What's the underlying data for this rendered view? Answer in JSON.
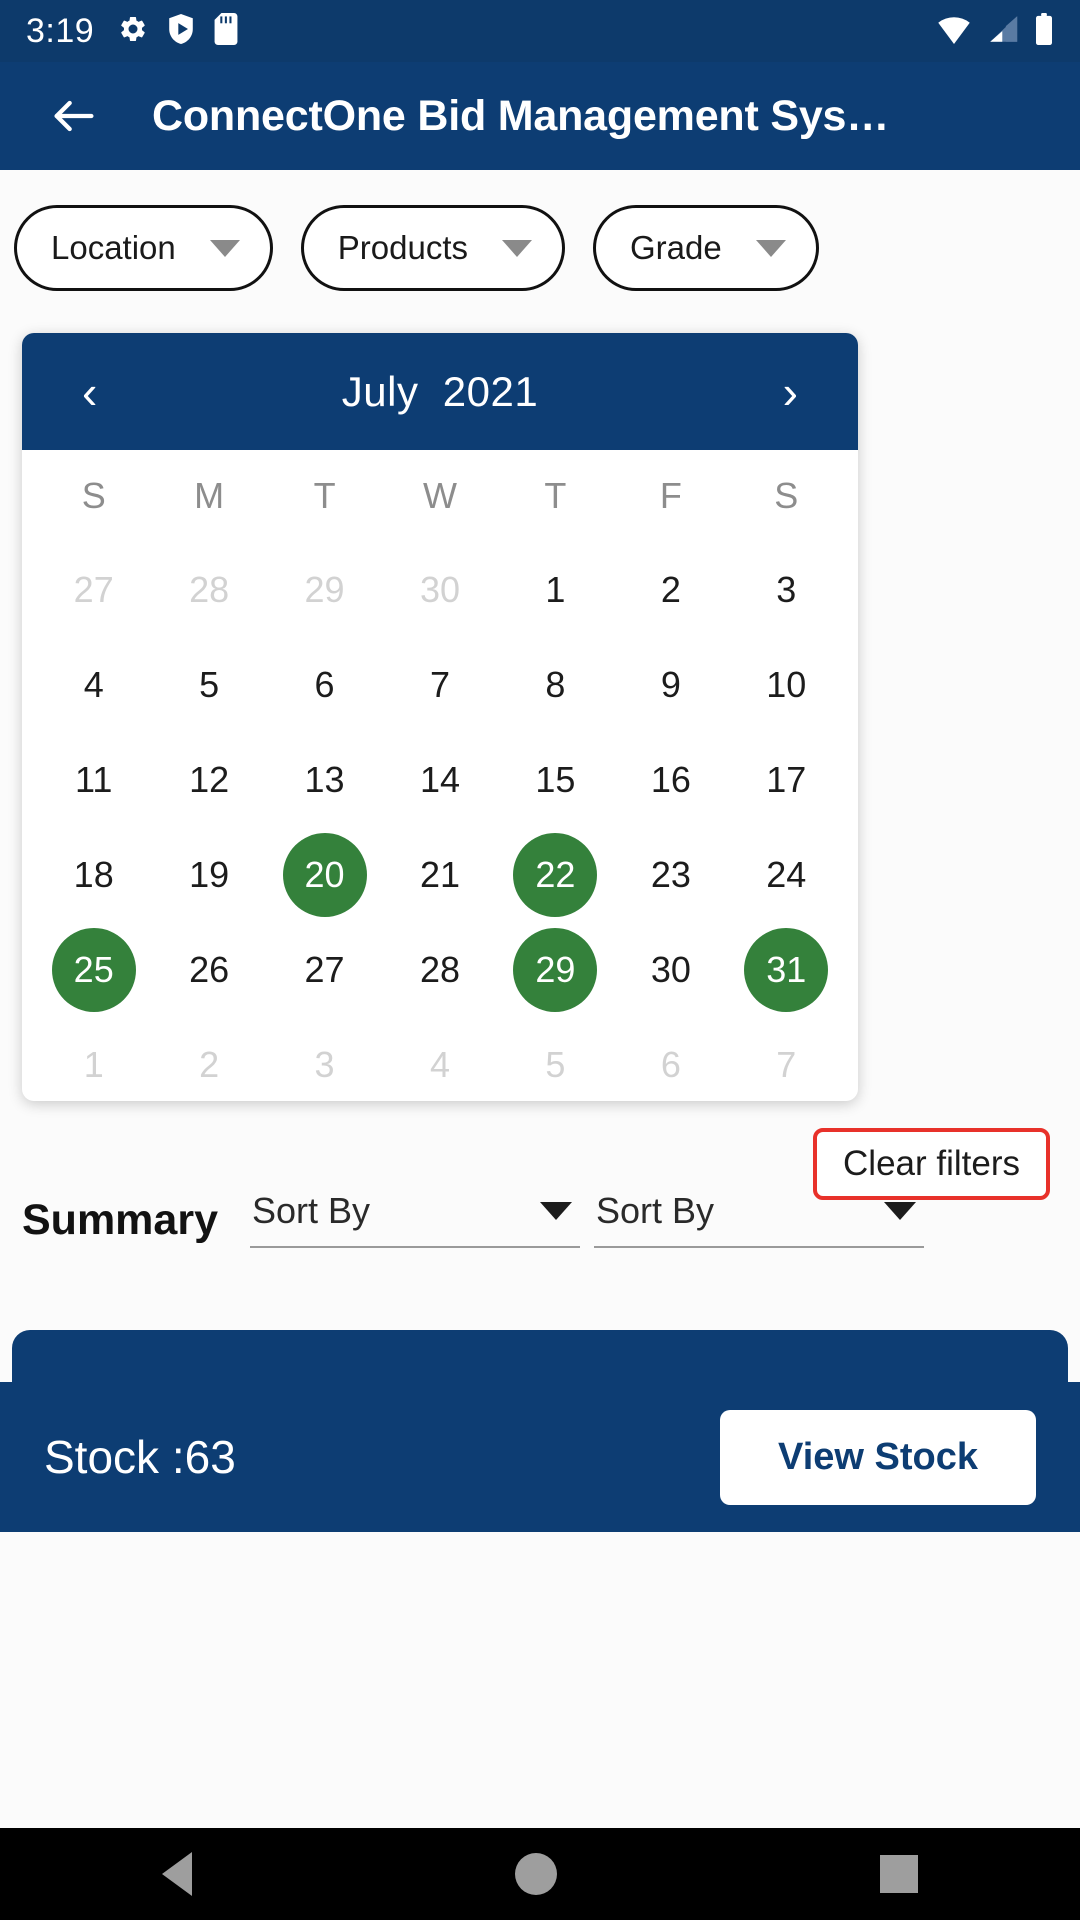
{
  "status_bar": {
    "time": "3:19",
    "left_icons": [
      "gear-icon",
      "shield-play-icon",
      "sd-card-icon"
    ],
    "right_icons": [
      "wifi-icon",
      "cellular-signal-icon",
      "battery-icon"
    ]
  },
  "app_bar": {
    "back_icon": "back-arrow-icon",
    "title": "ConnectOne Bid Management Sys…"
  },
  "filters": {
    "chips": [
      {
        "label": "Location",
        "caret": "chevron-down-icon"
      },
      {
        "label": "Products",
        "caret": "chevron-down-icon"
      },
      {
        "label": "Grade",
        "caret": "chevron-down-icon"
      }
    ]
  },
  "calendar": {
    "prev_label": "‹",
    "next_label": "›",
    "title": "July  2021",
    "month": "July",
    "year": "2021",
    "weekdays": [
      "S",
      "M",
      "T",
      "W",
      "T",
      "F",
      "S"
    ],
    "weeks": [
      [
        {
          "d": "27",
          "muted": true,
          "selected": false
        },
        {
          "d": "28",
          "muted": true,
          "selected": false
        },
        {
          "d": "29",
          "muted": true,
          "selected": false
        },
        {
          "d": "30",
          "muted": true,
          "selected": false
        },
        {
          "d": "1",
          "muted": false,
          "selected": false
        },
        {
          "d": "2",
          "muted": false,
          "selected": false
        },
        {
          "d": "3",
          "muted": false,
          "selected": false
        }
      ],
      [
        {
          "d": "4",
          "muted": false,
          "selected": false
        },
        {
          "d": "5",
          "muted": false,
          "selected": false
        },
        {
          "d": "6",
          "muted": false,
          "selected": false
        },
        {
          "d": "7",
          "muted": false,
          "selected": false
        },
        {
          "d": "8",
          "muted": false,
          "selected": false
        },
        {
          "d": "9",
          "muted": false,
          "selected": false
        },
        {
          "d": "10",
          "muted": false,
          "selected": false
        }
      ],
      [
        {
          "d": "11",
          "muted": false,
          "selected": false
        },
        {
          "d": "12",
          "muted": false,
          "selected": false
        },
        {
          "d": "13",
          "muted": false,
          "selected": false
        },
        {
          "d": "14",
          "muted": false,
          "selected": false
        },
        {
          "d": "15",
          "muted": false,
          "selected": false
        },
        {
          "d": "16",
          "muted": false,
          "selected": false
        },
        {
          "d": "17",
          "muted": false,
          "selected": false
        }
      ],
      [
        {
          "d": "18",
          "muted": false,
          "selected": false
        },
        {
          "d": "19",
          "muted": false,
          "selected": false
        },
        {
          "d": "20",
          "muted": false,
          "selected": true
        },
        {
          "d": "21",
          "muted": false,
          "selected": false
        },
        {
          "d": "22",
          "muted": false,
          "selected": true
        },
        {
          "d": "23",
          "muted": false,
          "selected": false
        },
        {
          "d": "24",
          "muted": false,
          "selected": false
        }
      ],
      [
        {
          "d": "25",
          "muted": false,
          "selected": true
        },
        {
          "d": "26",
          "muted": false,
          "selected": false
        },
        {
          "d": "27",
          "muted": false,
          "selected": false
        },
        {
          "d": "28",
          "muted": false,
          "selected": false
        },
        {
          "d": "29",
          "muted": false,
          "selected": true
        },
        {
          "d": "30",
          "muted": false,
          "selected": false
        },
        {
          "d": "31",
          "muted": false,
          "selected": true
        }
      ],
      [
        {
          "d": "1",
          "muted": true,
          "selected": false
        },
        {
          "d": "2",
          "muted": true,
          "selected": false
        },
        {
          "d": "3",
          "muted": true,
          "selected": false
        },
        {
          "d": "4",
          "muted": true,
          "selected": false
        },
        {
          "d": "5",
          "muted": true,
          "selected": false
        },
        {
          "d": "6",
          "muted": true,
          "selected": false
        },
        {
          "d": "7",
          "muted": true,
          "selected": false
        }
      ]
    ],
    "selected_days": [
      "20",
      "22",
      "25",
      "29",
      "31"
    ]
  },
  "actions": {
    "clear_filters": "Clear filters"
  },
  "summary": {
    "title": "Summary",
    "sort_fields": [
      {
        "label": "Sort By",
        "caret": "chevron-down-icon"
      },
      {
        "label": "Sort By",
        "caret": "chevron-down-icon"
      }
    ]
  },
  "stock": {
    "label": "Stock :63",
    "view_button": "View Stock"
  },
  "nav_bar": {
    "back": "nav-back-icon",
    "home": "nav-home-icon",
    "recents": "nav-recents-icon"
  },
  "colors": {
    "navy": "#0d3d73",
    "status_navy": "#0d3a6b",
    "selected_green": "#34813b",
    "highlight_red": "#e8312a",
    "muted_gray": "#d2d2d2"
  }
}
